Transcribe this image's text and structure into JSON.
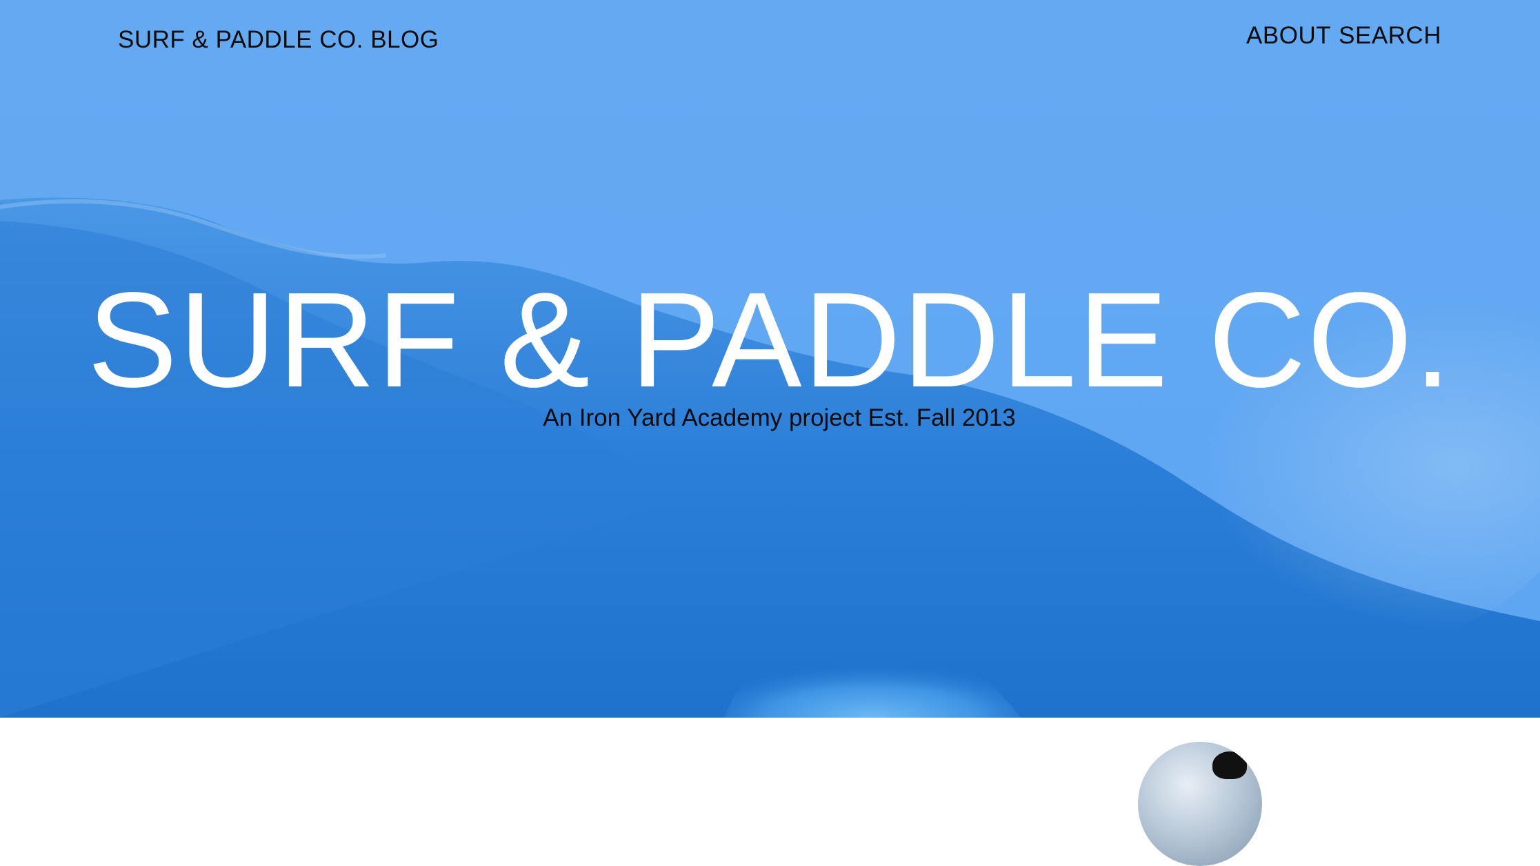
{
  "header": {
    "site_title": "SURF & PADDLE CO. BLOG",
    "nav": {
      "about": "ABOUT",
      "search": "SEARCH"
    }
  },
  "hero": {
    "title": "SURF & PADDLE CO.",
    "subtitle": "An Iron Yard Academy project Est. Fall 2013"
  },
  "icons": {
    "avatar": "author-avatar"
  },
  "colors": {
    "hero_sky": "#63a8f2",
    "hero_wave_dark": "#1f74cf",
    "hero_title": "#ffffff",
    "text_dark": "#0b0b0b"
  }
}
